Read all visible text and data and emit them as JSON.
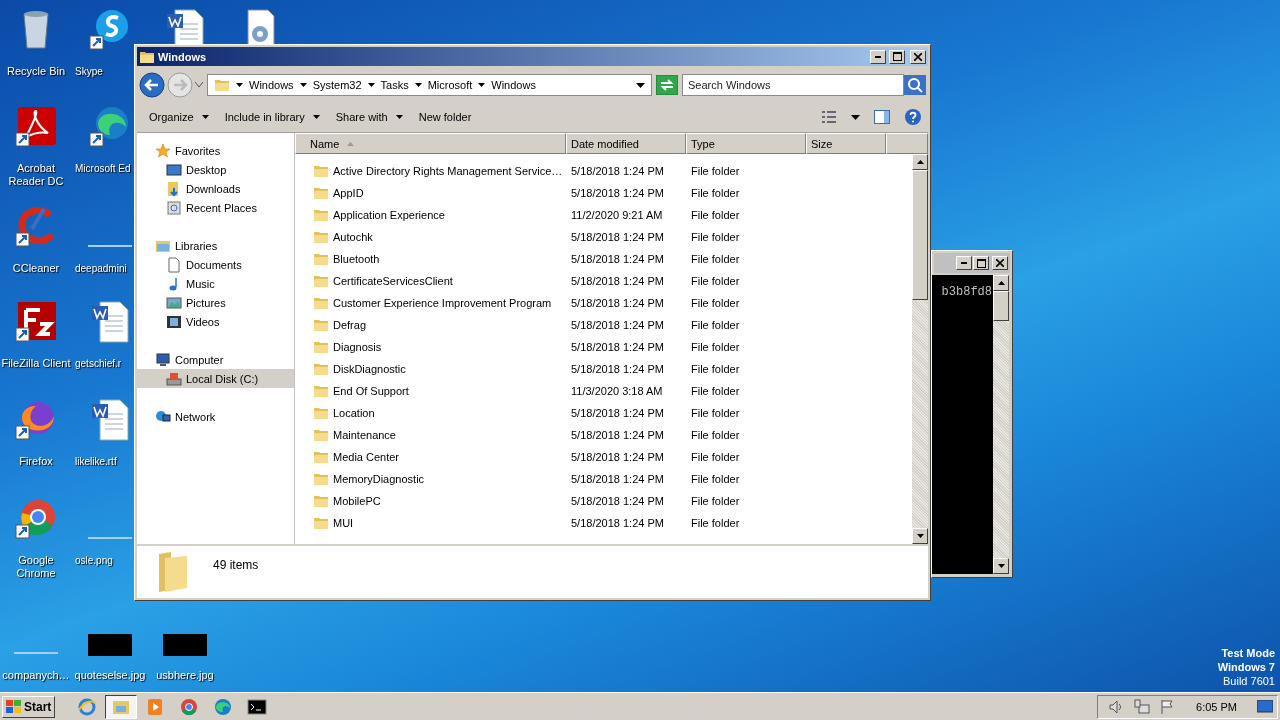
{
  "desktop_icons": [
    {
      "label": "Recycle Bin"
    },
    {
      "label": "Skype"
    },
    {
      "label": "Acrobat Reader DC"
    },
    {
      "label": "Microsoft Ed"
    },
    {
      "label": "CCleaner"
    },
    {
      "label": "deepadmini"
    },
    {
      "label": "FileZilla Client"
    },
    {
      "label": "getschief.r"
    },
    {
      "label": "Firefox"
    },
    {
      "label": "likelike.rtf"
    },
    {
      "label": "Google Chrome"
    },
    {
      "label": "osle.png"
    },
    {
      "label": "companych…"
    },
    {
      "label": "quoteselse.jpg"
    },
    {
      "label": "usbhere.jpg"
    }
  ],
  "explorer": {
    "title": "Windows",
    "breadcrumbs": [
      "Windows",
      "System32",
      "Tasks",
      "Microsoft",
      "Windows"
    ],
    "search": {
      "placeholder": "Search Windows"
    },
    "toolbar": [
      {
        "label": "Organize",
        "has_menu": true
      },
      {
        "label": "Include in library",
        "has_menu": true
      },
      {
        "label": "Share with",
        "has_menu": true
      },
      {
        "label": "New folder",
        "has_menu": false
      }
    ],
    "nav": [
      {
        "label": "Favorites",
        "selected": false,
        "children": [
          {
            "label": "Desktop",
            "selected": false
          },
          {
            "label": "Downloads",
            "selected": false
          },
          {
            "label": "Recent Places",
            "selected": false
          }
        ]
      },
      {
        "label": "Libraries",
        "selected": false,
        "children": [
          {
            "label": "Documents",
            "selected": false
          },
          {
            "label": "Music",
            "selected": false
          },
          {
            "label": "Pictures",
            "selected": false
          },
          {
            "label": "Videos",
            "selected": false
          }
        ]
      },
      {
        "label": "Computer",
        "selected": false,
        "children": [
          {
            "label": "Local Disk (C:)",
            "selected": true
          }
        ]
      },
      {
        "label": "Network",
        "selected": false
      }
    ],
    "columns": [
      {
        "label": "Name",
        "sorted": true
      },
      {
        "label": "Date modified",
        "sorted": false
      },
      {
        "label": "Type",
        "sorted": false
      },
      {
        "label": "Size",
        "sorted": false
      }
    ],
    "rows": [
      {
        "name": "Active Directory Rights Management Service…",
        "date": "5/18/2018 1:24 PM",
        "type": "File folder"
      },
      {
        "name": "AppID",
        "date": "5/18/2018 1:24 PM",
        "type": "File folder"
      },
      {
        "name": "Application Experience",
        "date": "11/2/2020 9:21 AM",
        "type": "File folder"
      },
      {
        "name": "Autochk",
        "date": "5/18/2018 1:24 PM",
        "type": "File folder"
      },
      {
        "name": "Bluetooth",
        "date": "5/18/2018 1:24 PM",
        "type": "File folder"
      },
      {
        "name": "CertificateServicesClient",
        "date": "5/18/2018 1:24 PM",
        "type": "File folder"
      },
      {
        "name": "Customer Experience Improvement Program",
        "date": "5/18/2018 1:24 PM",
        "type": "File folder"
      },
      {
        "name": "Defrag",
        "date": "5/18/2018 1:24 PM",
        "type": "File folder"
      },
      {
        "name": "Diagnosis",
        "date": "5/18/2018 1:24 PM",
        "type": "File folder"
      },
      {
        "name": "DiskDiagnostic",
        "date": "5/18/2018 1:24 PM",
        "type": "File folder"
      },
      {
        "name": "End Of Support",
        "date": "11/3/2020 3:18 AM",
        "type": "File folder"
      },
      {
        "name": "Location",
        "date": "5/18/2018 1:24 PM",
        "type": "File folder"
      },
      {
        "name": "Maintenance",
        "date": "5/18/2018 1:24 PM",
        "type": "File folder"
      },
      {
        "name": "Media Center",
        "date": "5/18/2018 1:24 PM",
        "type": "File folder"
      },
      {
        "name": "MemoryDiagnostic",
        "date": "5/18/2018 1:24 PM",
        "type": "File folder"
      },
      {
        "name": "MobilePC",
        "date": "5/18/2018 1:24 PM",
        "type": "File folder"
      },
      {
        "name": "MUI",
        "date": "5/18/2018 1:24 PM",
        "type": "File folder"
      }
    ],
    "status": "49 items"
  },
  "console": {
    "text": "b3b8fd8"
  },
  "taskbar": {
    "start": "Start",
    "apps": [
      {
        "selected": false
      },
      {
        "selected": true
      },
      {
        "selected": false
      },
      {
        "selected": false
      },
      {
        "selected": false
      },
      {
        "selected": false
      }
    ],
    "clock": "6:05 PM"
  },
  "os_notice": [
    "Test Mode",
    "Windows 7",
    "Build 7601"
  ]
}
